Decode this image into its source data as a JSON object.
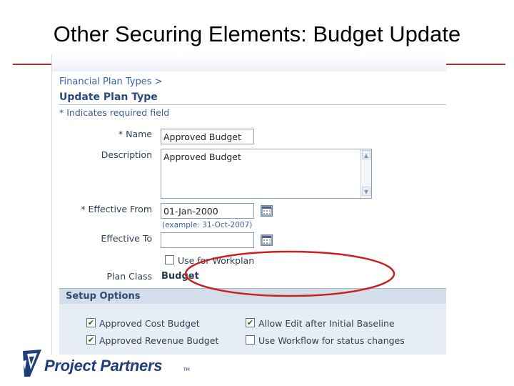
{
  "slide": {
    "title": "Other Securing Elements: Budget Update",
    "accent_color": "#c0282a"
  },
  "page": {
    "breadcrumb": "Financial Plan Types  >",
    "heading": "Update Plan Type",
    "required_note": "*  Indicates required field"
  },
  "form": {
    "name": {
      "label": "* Name",
      "value": "Approved Budget"
    },
    "description": {
      "label": "Description",
      "value": "Approved Budget"
    },
    "effective_from": {
      "label": "* Effective From",
      "value": "01-Jan-2000",
      "hint": "(example: 31-Oct-2007)"
    },
    "effective_to": {
      "label": "Effective To",
      "value": ""
    },
    "use_for_workplan": {
      "label": "Use for Workplan",
      "checked": false
    },
    "plan_class": {
      "label": "Plan Class",
      "value": "Budget"
    }
  },
  "setup": {
    "header": "Setup Options",
    "options": [
      {
        "label": "Approved Cost Budget",
        "checked": true
      },
      {
        "label": "Approved Revenue Budget",
        "checked": true
      },
      {
        "label": "Allow Edit after Initial Baseline",
        "checked": true
      },
      {
        "label": "Use Workflow for status changes",
        "checked": false
      }
    ],
    "highlight_color": "#cc1f1f"
  },
  "icons": {
    "calendar": "calendar-icon",
    "scroll_up": "scroll-up-icon",
    "scroll_down": "scroll-down-icon",
    "check": "✔"
  },
  "logo": {
    "text": "Project Partners",
    "tm": "TM",
    "color": "#1f3f7a"
  }
}
